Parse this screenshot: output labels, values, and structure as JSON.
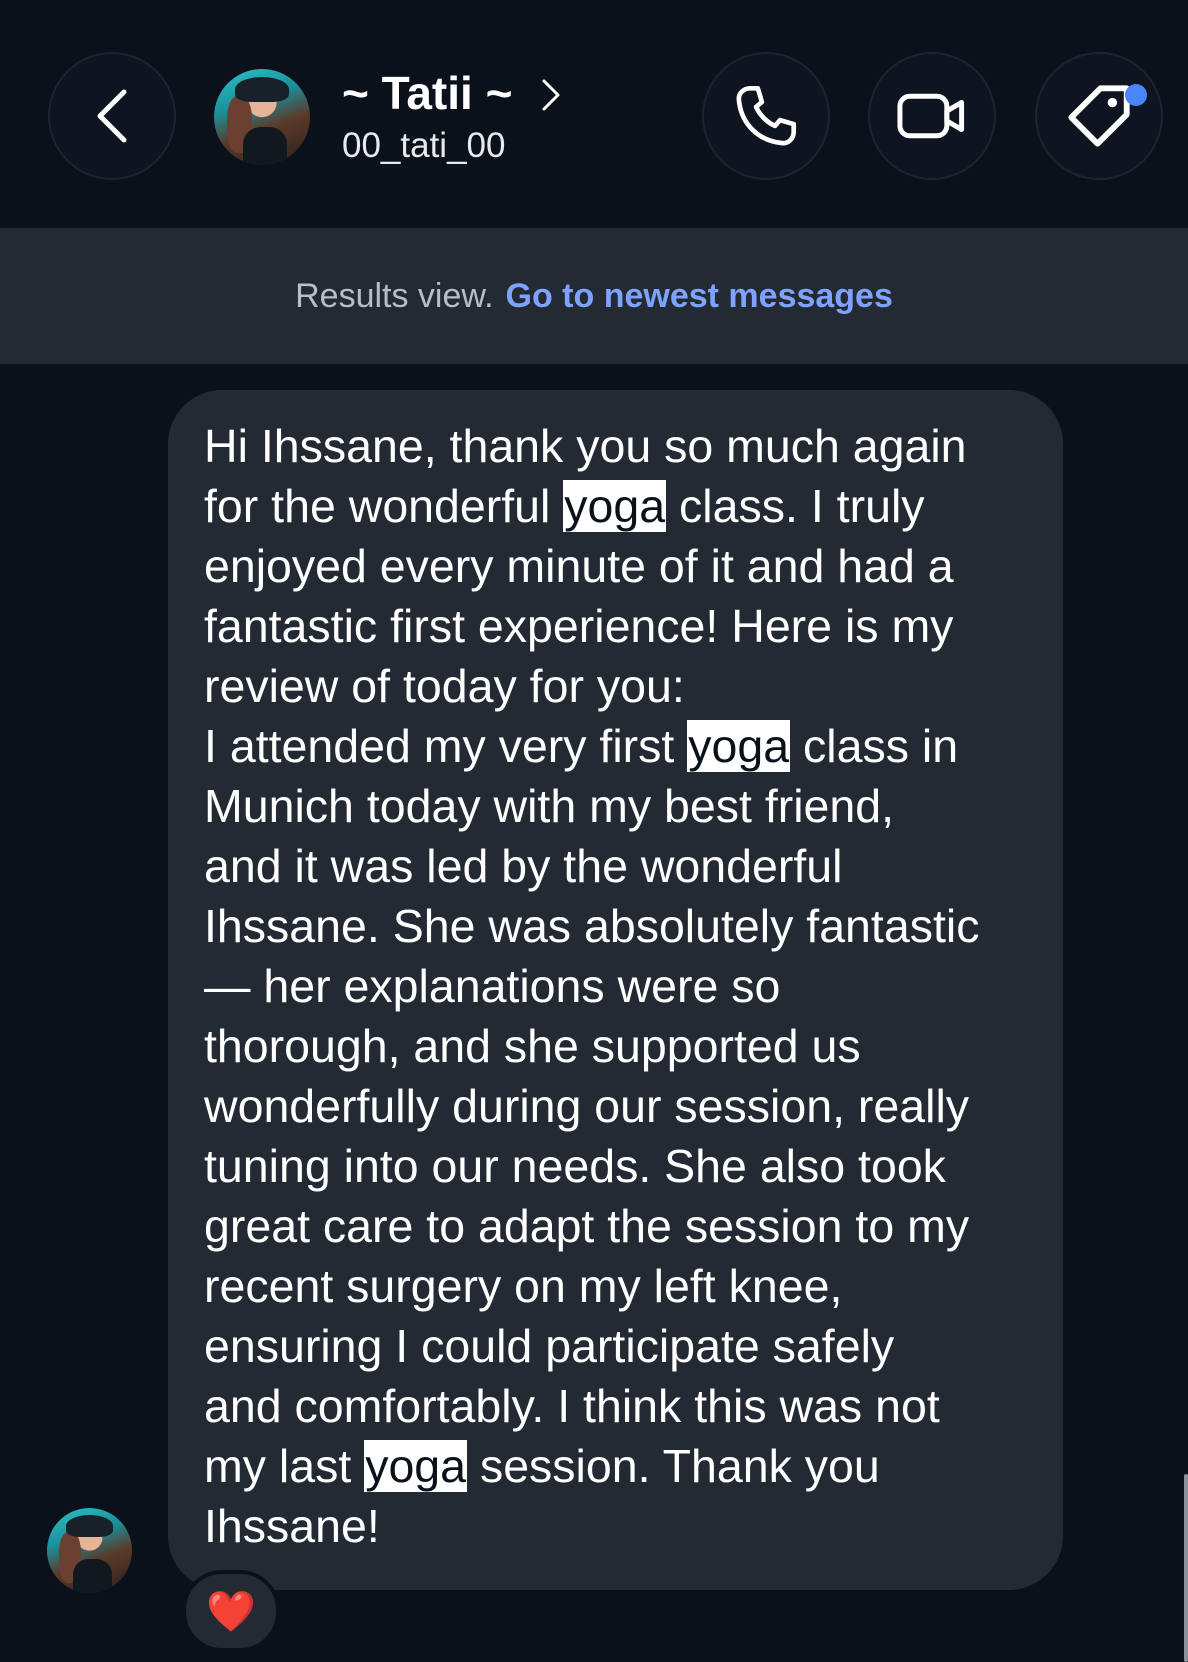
{
  "header": {
    "name": "~ Tatii ~",
    "handle": "00_tati_00",
    "icons": [
      "back-arrow-icon",
      "chevron-right-icon",
      "phone-icon",
      "video-camera-icon",
      "tag-icon"
    ],
    "notification_dot_color": "#4a86f7"
  },
  "results_bar": {
    "label": "Results view.",
    "link": "Go to newest messages",
    "link_color": "#7ea3ff"
  },
  "message": {
    "highlight_term": "yoga",
    "lines": [
      [
        "Hi Ihssane, thank you so much again"
      ],
      [
        "for the wonderful ",
        {
          "hl": "yoga"
        },
        " class. I truly"
      ],
      [
        "enjoyed every minute of it and had a"
      ],
      [
        "fantastic first experience! Here is my"
      ],
      [
        "review of today for you:"
      ],
      [
        "I attended my very first ",
        {
          "hl": "yoga"
        },
        " class in"
      ],
      [
        "Munich today with my best friend,"
      ],
      [
        "and it was led by the wonderful"
      ],
      [
        "Ihssane. She was absolutely fantastic"
      ],
      [
        "— her explanations were so"
      ],
      [
        "thorough, and she supported us"
      ],
      [
        "wonderfully during our session, really"
      ],
      [
        "tuning into our needs. She also took"
      ],
      [
        "great care to adapt the session to my"
      ],
      [
        "recent surgery on my left knee,"
      ],
      [
        "ensuring I could participate safely"
      ],
      [
        "and comfortably. I think this was not"
      ],
      [
        "my last ",
        {
          "hl": "yoga"
        },
        " session. Thank you"
      ],
      [
        "Ihssane!"
      ]
    ]
  },
  "reaction": {
    "emoji": "❤️",
    "icon": "heart-icon"
  }
}
